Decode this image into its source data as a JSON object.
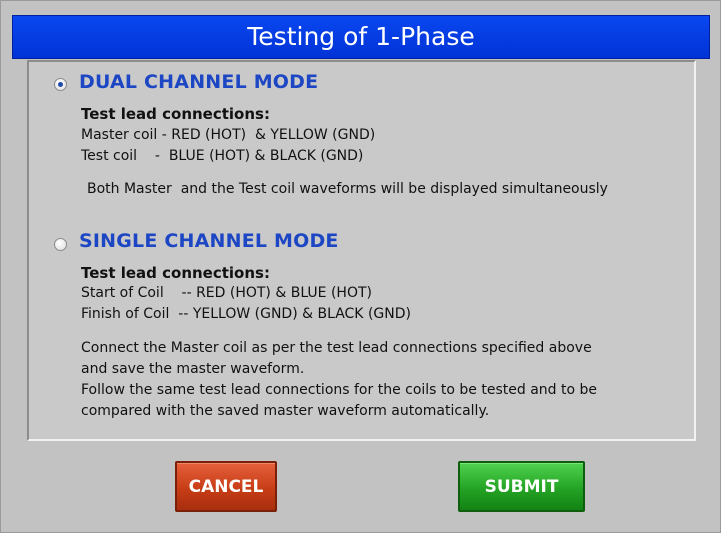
{
  "window": {
    "title": "Testing of 1-Phase"
  },
  "dual": {
    "label": "DUAL CHANNEL MODE",
    "selected": true,
    "heading": "Test lead connections:",
    "line1": "Master coil - RED (HOT)  & YELLOW (GND)",
    "line2": "Test coil    -  BLUE (HOT) & BLACK (GND)",
    "note": "Both Master  and the Test coil waveforms will be displayed simultaneously"
  },
  "single": {
    "label": "SINGLE CHANNEL MODE",
    "selected": false,
    "heading": "Test lead connections:",
    "line1": "Start of Coil    -- RED (HOT) & BLUE (HOT)",
    "line2": "Finish of Coil  -- YELLOW (GND) & BLACK (GND)",
    "note1": "Connect the Master coil as per the test lead connections specified above",
    "note2": "and save the master waveform.",
    "note3": "Follow the same test lead connections for the coils to be tested and to be",
    "note4": "compared with the saved master waveform automatically."
  },
  "buttons": {
    "cancel": "CANCEL",
    "submit": "SUBMIT"
  },
  "colors": {
    "title_bar": "#0a47f0",
    "mode_label": "#1c46c4",
    "cancel": "#c73d16",
    "submit": "#24a324"
  }
}
